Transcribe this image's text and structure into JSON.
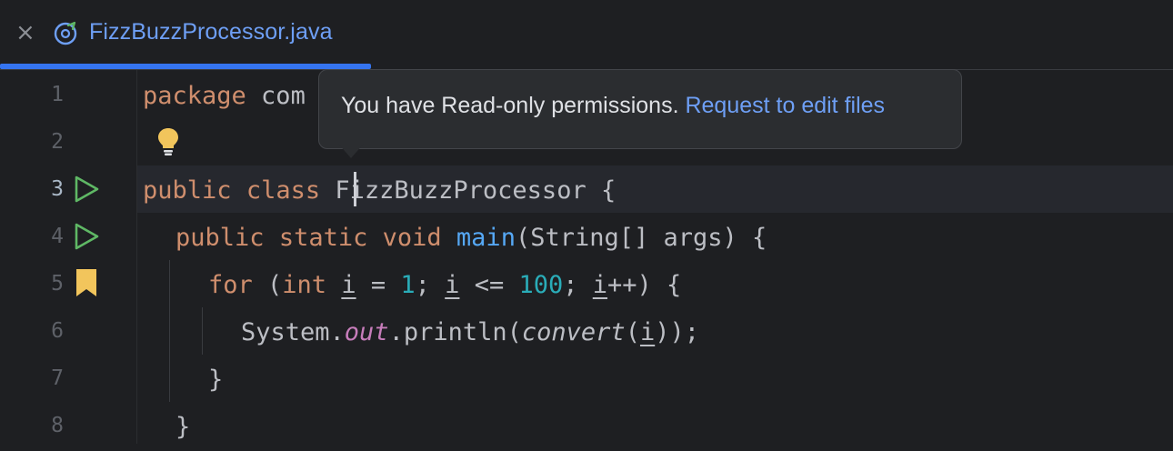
{
  "tab": {
    "title": "FizzBuzzProcessor.java",
    "close_glyph": "×",
    "icon": "java-class-icon"
  },
  "gutter": {
    "line_numbers": [
      "1",
      "2",
      "3",
      "4",
      "5",
      "6",
      "7",
      "8"
    ],
    "icons": [
      "run-icon",
      "run-icon",
      "bookmark-icon",
      "lightbulb-icon"
    ]
  },
  "code": {
    "l1_kw": "package",
    "l1_rest": " com",
    "l3_kw1": "public",
    "l3_kw2": "class",
    "l3_name": "FizzBuzzProcessor",
    "l3_brace": " {",
    "l4_kw1": "public",
    "l4_kw2": "static",
    "l4_kw3": "void",
    "l4_fn": "main",
    "l4_rest": "(String[] args) {",
    "l5_kw": "for",
    "l5_p1": " (",
    "l5_int": "int",
    "l5_var1": "i",
    "l5_eq": " = ",
    "l5_n1": "1",
    "l5_semi1": "; ",
    "l5_var2": "i",
    "l5_le": " <= ",
    "l5_n2": "100",
    "l5_semi2": "; ",
    "l5_var3": "i",
    "l5_end": "++) {",
    "l6_sys": "System.",
    "l6_out": "out",
    "l6_println": ".println(",
    "l6_convert": "convert",
    "l6_p": "(",
    "l6_var": "i",
    "l6_end": "));",
    "l7": "}",
    "l8": "}"
  },
  "tooltip": {
    "message": "You have Read-only permissions. ",
    "link": "Request to edit files"
  },
  "colors": {
    "accent": "#3574f0",
    "keyword": "#cf8e6d",
    "function": "#56a8f5",
    "number": "#2aacb8",
    "static_field": "#c77dbb",
    "run_icon": "#5fb865",
    "bookmark": "#f2c55c"
  }
}
